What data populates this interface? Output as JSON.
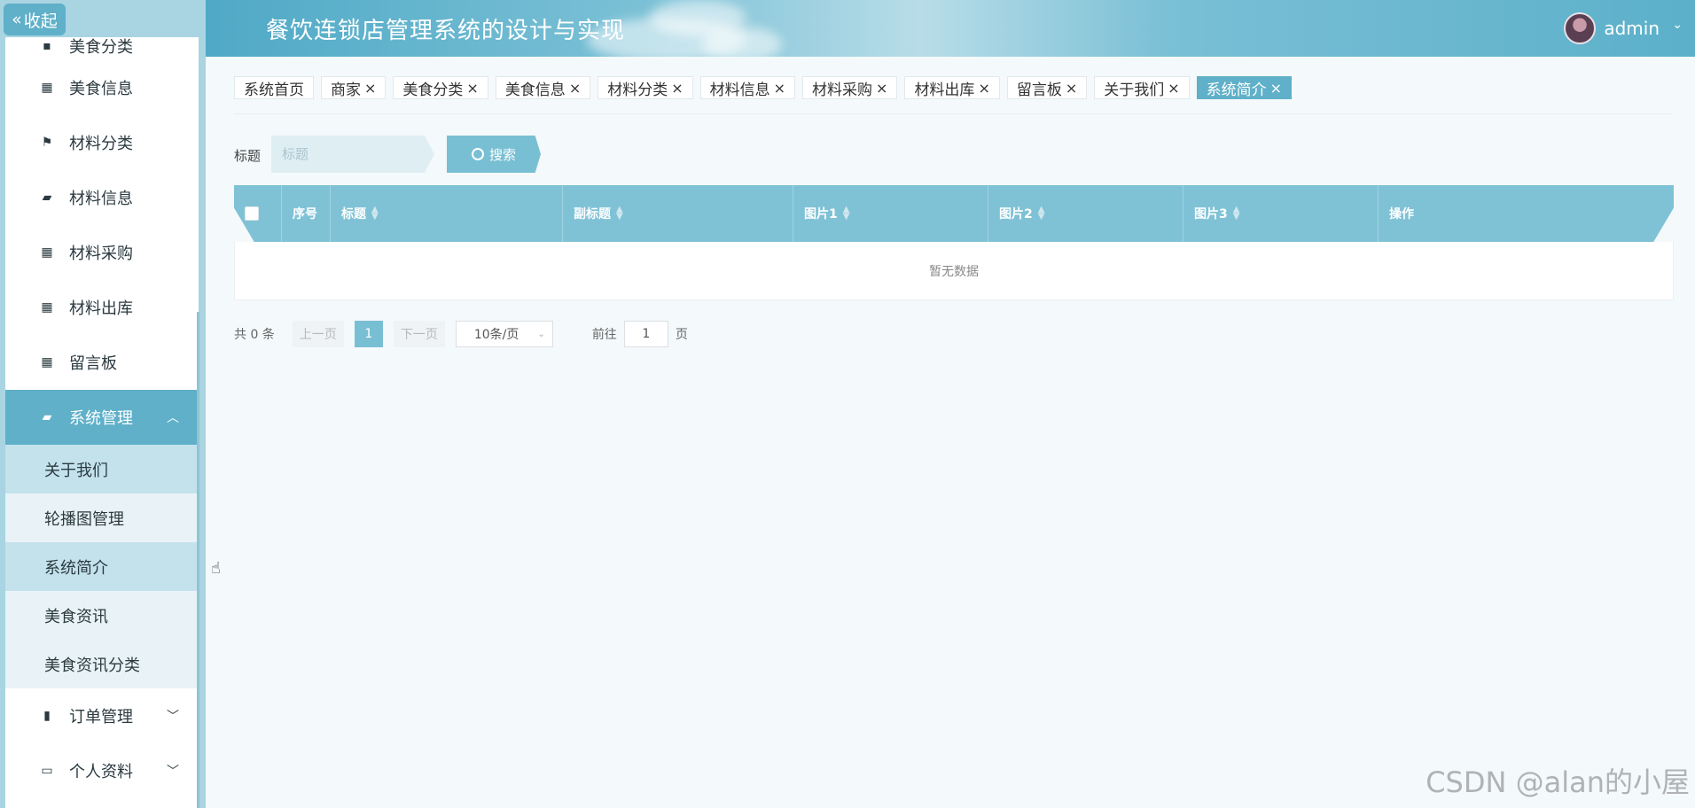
{
  "colors": {
    "accent": "#5fb0c8",
    "sidebar_bg": "#a9d4e1",
    "table_header": "#7fc2d6"
  },
  "sidebar": {
    "collapse_icon": "double-chevron-left-icon",
    "collapse_label": "收起",
    "items": [
      {
        "label": "美食分类",
        "icon": "tag-icon",
        "glyph": "▪"
      },
      {
        "label": "美食信息",
        "icon": "grid-icon",
        "glyph": "▦"
      },
      {
        "label": "材料分类",
        "icon": "flag-icon",
        "glyph": "⚑"
      },
      {
        "label": "材料信息",
        "icon": "briefcase-icon",
        "glyph": "▰"
      },
      {
        "label": "材料采购",
        "icon": "grid-icon",
        "glyph": "▦"
      },
      {
        "label": "材料出库",
        "icon": "grid-icon",
        "glyph": "▦"
      },
      {
        "label": "留言板",
        "icon": "apps-icon",
        "glyph": "▦"
      }
    ],
    "system_group": {
      "label": "系统管理",
      "icon": "briefcase-icon",
      "glyph": "▰",
      "expanded": true,
      "children": [
        "关于我们",
        "轮播图管理",
        "系统简介",
        "美食资讯",
        "美食资讯分类"
      ]
    },
    "order_group": {
      "label": "订单管理",
      "icon": "book-icon",
      "glyph": "▮"
    },
    "profile_group": {
      "label": "个人资料",
      "icon": "card-icon",
      "glyph": "▭"
    }
  },
  "header": {
    "title": "餐饮连锁店管理系统的设计与实现",
    "user": "admin"
  },
  "tags": [
    {
      "label": "系统首页",
      "closable": false,
      "active": false
    },
    {
      "label": "商家",
      "closable": true,
      "active": false
    },
    {
      "label": "美食分类",
      "closable": true,
      "active": false
    },
    {
      "label": "美食信息",
      "closable": true,
      "active": false
    },
    {
      "label": "材料分类",
      "closable": true,
      "active": false
    },
    {
      "label": "材料信息",
      "closable": true,
      "active": false
    },
    {
      "label": "材料采购",
      "closable": true,
      "active": false
    },
    {
      "label": "材料出库",
      "closable": true,
      "active": false
    },
    {
      "label": "留言板",
      "closable": true,
      "active": false
    },
    {
      "label": "关于我们",
      "closable": true,
      "active": false
    },
    {
      "label": "系统简介",
      "closable": true,
      "active": true
    }
  ],
  "tag_close": "×",
  "search": {
    "label": "标题",
    "placeholder": "标题",
    "button_label": "搜索"
  },
  "table": {
    "columns": [
      {
        "label": "序号",
        "sortable": false,
        "w": 55
      },
      {
        "label": "标题",
        "sortable": true,
        "w": 262
      },
      {
        "label": "副标题",
        "sortable": true,
        "w": 260
      },
      {
        "label": "图片1",
        "sortable": true,
        "w": 220
      },
      {
        "label": "图片2",
        "sortable": true,
        "w": 220
      },
      {
        "label": "图片3",
        "sortable": true,
        "w": 220
      },
      {
        "label": "操作",
        "sortable": false,
        "w": 328
      }
    ],
    "empty_text": "暂无数据"
  },
  "pagination": {
    "total_text": "共 0 条",
    "prev": "上一页",
    "current": "1",
    "next": "下一页",
    "page_size": "10条/页",
    "goto_prefix": "前往",
    "goto_value": "1",
    "goto_suffix": "页"
  },
  "watermark": "CSDN @alan的小屋"
}
